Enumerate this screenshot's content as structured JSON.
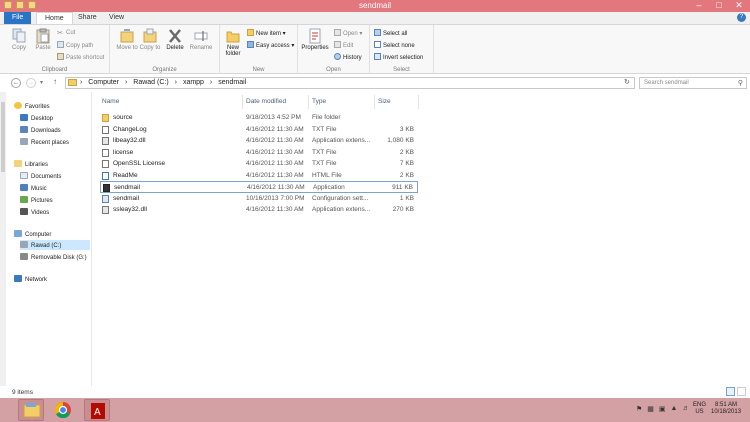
{
  "window": {
    "title": "sendmail"
  },
  "ribbon_tabs": [
    "File",
    "Home",
    "Share",
    "View"
  ],
  "ribbon": {
    "clipboard": {
      "label": "Clipboard",
      "copy": "Copy",
      "paste": "Paste",
      "cut": "Cut",
      "copy_path": "Copy path",
      "paste_shortcut": "Paste shortcut"
    },
    "organize": {
      "label": "Organize",
      "move_to": "Move to",
      "copy_to": "Copy to",
      "delete": "Delete",
      "rename": "Rename"
    },
    "new": {
      "label": "New",
      "new_folder": "New folder",
      "new_item": "New item",
      "easy_access": "Easy access"
    },
    "open": {
      "label": "Open",
      "properties": "Properties",
      "open": "Open",
      "edit": "Edit",
      "history": "History"
    },
    "select": {
      "label": "Select",
      "select_all": "Select all",
      "select_none": "Select none",
      "invert_selection": "Invert selection"
    }
  },
  "address": {
    "crumbs": [
      "Computer",
      "Rawad (C:)",
      "xampp",
      "sendmail"
    ],
    "search_placeholder": "Search sendmail"
  },
  "nav": {
    "favorites": "Favorites",
    "desktop": "Desktop",
    "downloads": "Downloads",
    "recent": "Recent places",
    "libraries": "Libraries",
    "documents": "Documents",
    "music": "Music",
    "pictures": "Pictures",
    "videos": "Videos",
    "computer": "Computer",
    "rawad": "Rawad (C:)",
    "removable": "Removable Disk (G:)",
    "network": "Network"
  },
  "columns": {
    "name": "Name",
    "date": "Date modified",
    "type": "Type",
    "size": "Size"
  },
  "files": [
    {
      "name": "source",
      "date": "9/18/2013 4:52 PM",
      "type": "File folder",
      "size": "",
      "icon": "folder-icon"
    },
    {
      "name": "ChangeLog",
      "date": "4/16/2012 11:30 AM",
      "type": "TXT File",
      "size": "3 KB",
      "icon": "text-file-icon"
    },
    {
      "name": "libeay32.dll",
      "date": "4/16/2012 11:30 AM",
      "type": "Application extens...",
      "size": "1,080 KB",
      "icon": "dll-file-icon"
    },
    {
      "name": "license",
      "date": "4/16/2012 11:30 AM",
      "type": "TXT File",
      "size": "2 KB",
      "icon": "text-file-icon"
    },
    {
      "name": "OpenSSL License",
      "date": "4/16/2012 11:30 AM",
      "type": "TXT File",
      "size": "7 KB",
      "icon": "text-file-icon"
    },
    {
      "name": "ReadMe",
      "date": "4/16/2012 11:30 AM",
      "type": "HTML File",
      "size": "2 KB",
      "icon": "html-file-icon"
    },
    {
      "name": "sendmail",
      "date": "4/16/2012 11:30 AM",
      "type": "Application",
      "size": "911 KB",
      "icon": "application-icon"
    },
    {
      "name": "sendmail",
      "date": "10/16/2013 7:00 PM",
      "type": "Configuration sett...",
      "size": "1 KB",
      "icon": "config-file-icon"
    },
    {
      "name": "ssleay32.dll",
      "date": "4/16/2012 11:30 AM",
      "type": "Application extens...",
      "size": "270 KB",
      "icon": "dll-file-icon"
    }
  ],
  "status": {
    "items": "9 items"
  },
  "taskbar": {
    "lang": "ENG",
    "region": "US",
    "time": "8:51 AM",
    "date": "10/18/2013"
  },
  "colors": {
    "titlebar": "#e2787e",
    "taskbar": "#d3a0a4",
    "file_tab": "#2a74c8",
    "selection": "#7da2ce"
  }
}
